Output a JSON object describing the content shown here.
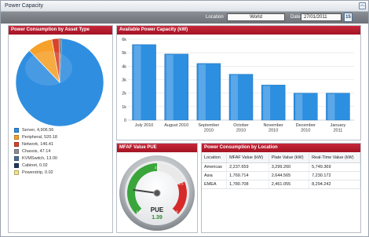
{
  "window": {
    "title": "Power Capacity",
    "collapse_icon": "chevron-up-icon"
  },
  "filter": {
    "location_label": "Location",
    "location_value": "World",
    "date_label": "Date",
    "date_value": "27/01/2011",
    "calendar_text": "15"
  },
  "panels": {
    "asset_title": "Power Consumption by Asset Type",
    "capacity_title": "Available Power Capacity (kW)",
    "mfaf_title": "MFAF Value PUE",
    "location_title": "Power Consumption by Location"
  },
  "colors": {
    "header_red": "#b31b2c",
    "pie_blue": "#2f8ee0",
    "pie_orange": "#f5a12a",
    "bar_blue": "#2d8fe0"
  },
  "asset_legend": [
    {
      "label": "Server, 4,906.56",
      "color": "#2f8ee0"
    },
    {
      "label": "Peripheral, 520.18",
      "color": "#f5a12a"
    },
    {
      "label": "Network, 146.41",
      "color": "#d8432c"
    },
    {
      "label": "Chassis, 47.14",
      "color": "#8c8f94"
    },
    {
      "label": "KVMSwitch, 13.00",
      "color": "#4b6f96"
    },
    {
      "label": "Cabinet, 0.02",
      "color": "#1e3a5c"
    },
    {
      "label": "Powerstrip, 0.02",
      "color": "#f1e38a"
    }
  ],
  "chart_data": [
    {
      "type": "pie",
      "title": "Power Consumption by Asset Type",
      "categories": [
        "Server",
        "Peripheral",
        "Network",
        "Chassis",
        "KVMSwitch",
        "Cabinet",
        "Powerstrip"
      ],
      "values": [
        4906.56,
        520.18,
        146.41,
        47.14,
        13.0,
        0.02,
        0.02
      ]
    },
    {
      "type": "bar",
      "title": "Available Power Capacity (kW)",
      "categories": [
        "July 2010",
        "August 2010",
        "September 2010",
        "October 2010",
        "November 2010",
        "December 2010",
        "January 2011"
      ],
      "values": [
        5.6,
        4.9,
        4.2,
        3.4,
        2.6,
        2.0,
        2.0
      ],
      "ylim": [
        0,
        6
      ],
      "yticks": [
        "0",
        "1k",
        "2k",
        "3k",
        "4k",
        "5k",
        "6k"
      ],
      "grid": true
    }
  ],
  "gauge": {
    "label": "PUE",
    "value": 1.39,
    "value_text": "1.39",
    "min": 1.0,
    "max": 3.0,
    "tick_labels": [
      "1.0",
      "2.0",
      "2.5",
      "3.0"
    ]
  },
  "location_table": {
    "columns": [
      "Location",
      "MFAF Value (kW)",
      "Plate Value (kW)",
      "Real-Time Value (kW)"
    ],
    "rows": [
      [
        "Americas",
        "2,237.659",
        "3,299.260",
        "5,749.369"
      ],
      [
        "Asia",
        "1,769.714",
        "2,644.565",
        "7,230.172"
      ],
      [
        "EMEA",
        "1,780.708",
        "2,461.055",
        "8,294.242"
      ]
    ]
  }
}
